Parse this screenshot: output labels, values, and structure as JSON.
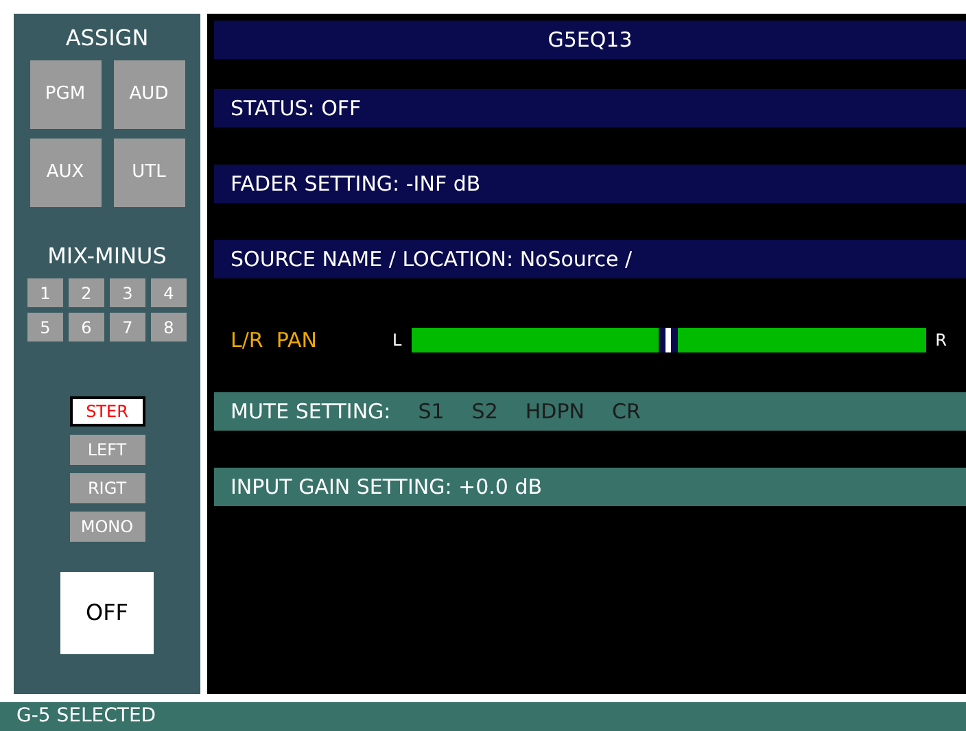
{
  "sidebar": {
    "assign_title": "ASSIGN",
    "assign_buttons": [
      {
        "label": "PGM",
        "selected": false
      },
      {
        "label": "AUD",
        "selected": false
      },
      {
        "label": "AUX",
        "selected": false
      },
      {
        "label": "UTL",
        "selected": false
      }
    ],
    "mix_minus_title": "MIX-MINUS",
    "mix_minus_buttons": [
      {
        "label": "1",
        "selected": false
      },
      {
        "label": "2",
        "selected": false
      },
      {
        "label": "3",
        "selected": false
      },
      {
        "label": "4",
        "selected": false
      },
      {
        "label": "5",
        "selected": false
      },
      {
        "label": "6",
        "selected": false
      },
      {
        "label": "7",
        "selected": false
      },
      {
        "label": "8",
        "selected": false
      }
    ],
    "modes": [
      {
        "label": "STER",
        "selected": true
      },
      {
        "label": "LEFT",
        "selected": false
      },
      {
        "label": "RIGT",
        "selected": false
      },
      {
        "label": "MONO",
        "selected": false
      }
    ],
    "on_off_button": "OFF"
  },
  "title": "G5EQ13",
  "status": "STATUS:  OFF",
  "fader": "FADER SETTING: -INF dB",
  "source": "SOURCE NAME / LOCATION: NoSource /",
  "pan": {
    "label": "L/R  PAN",
    "left": "L",
    "right": "R",
    "level": 0.5
  },
  "mute": {
    "label": "MUTE SETTING:",
    "items": [
      {
        "label": "S1",
        "on": false
      },
      {
        "label": "S2",
        "on": false
      },
      {
        "label": "HDPN",
        "on": false
      },
      {
        "label": "CR",
        "on": false
      }
    ]
  },
  "input_gain": "INPUT GAIN SETTING: +0.0 dB",
  "status_bar": "G-5 SELECTED"
}
